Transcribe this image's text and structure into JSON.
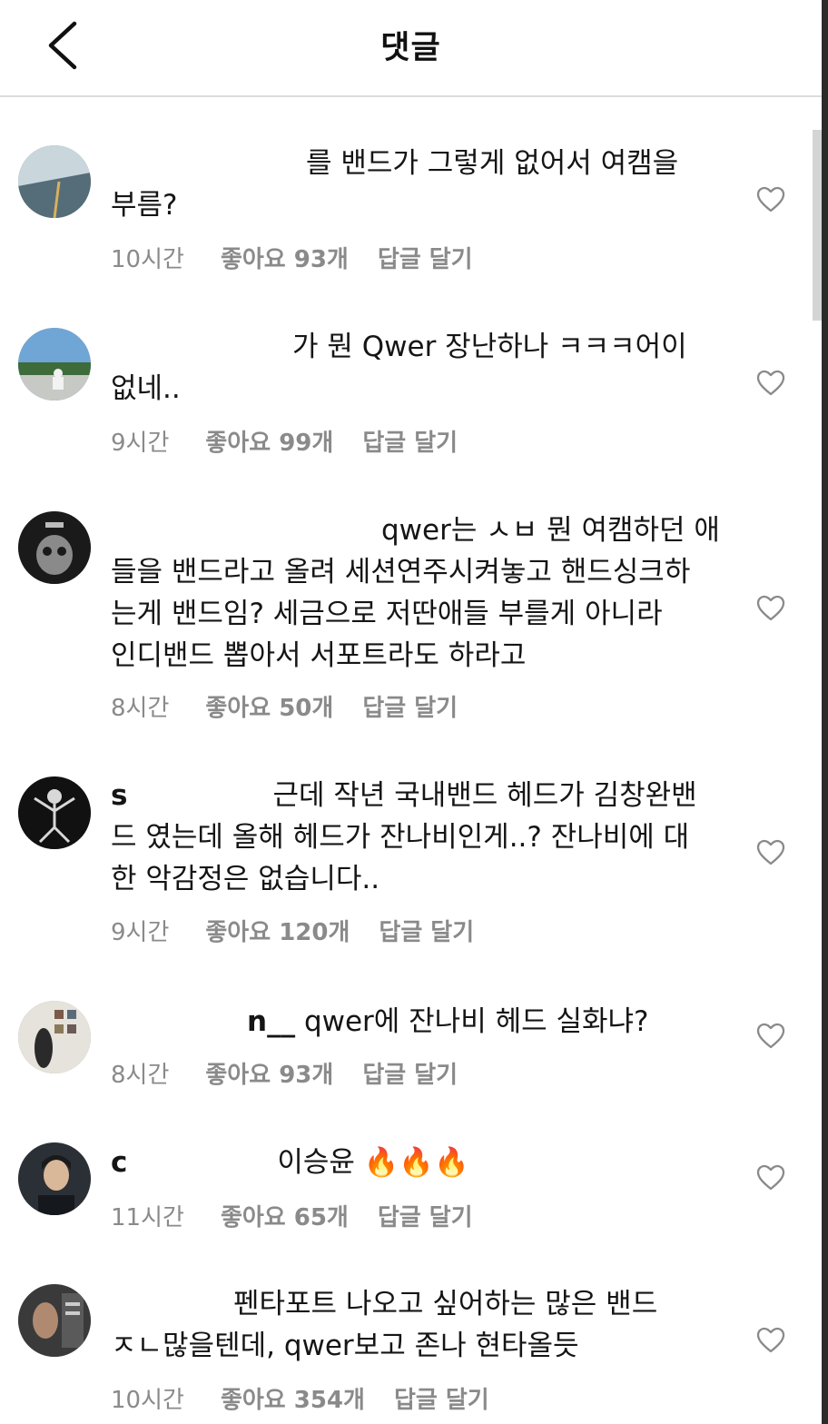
{
  "header": {
    "title": "댓글"
  },
  "comments": [
    {
      "user": "",
      "text": "를 밴드가 그렇게 없어서 여캠을\n부름?",
      "time": "10시간",
      "likes": "좋아요 93개",
      "reply": "답글 달기"
    },
    {
      "user": "",
      "text": "가 뭔 Qwer 장난하나 ㅋㅋㅋ어이\n없네..",
      "time": "9시간",
      "likes": "좋아요 99개",
      "reply": "답글 달기"
    },
    {
      "user": "",
      "text": "qwer는 ㅅㅂ 뭔 여캠하던 애\n들을 밴드라고 올려 세션연주시켜놓고 핸드싱크하\n는게 밴드임? 세금으로 저딴애들 부를게 아니라\n인디밴드 뽑아서 서포트라도 하라고",
      "time": "8시간",
      "likes": "좋아요 50개",
      "reply": "답글 달기"
    },
    {
      "user": "s",
      "text": "근데 작년 국내밴드 헤드가 김창완밴\n드 였는데 올해 헤드가 잔나비인게..? 잔나비에 대\n한 악감정은 없습니다..",
      "time": "9시간",
      "likes": "좋아요 120개",
      "reply": "답글 달기"
    },
    {
      "user": "n__",
      "text": "qwer에 잔나비 헤드 실화냐?",
      "time": "8시간",
      "likes": "좋아요 93개",
      "reply": "답글 달기"
    },
    {
      "user": "c",
      "text": "이승윤 🔥🔥🔥",
      "time": "11시간",
      "likes": "좋아요 65개",
      "reply": "답글 달기"
    },
    {
      "user": "",
      "text": "펜타포트 나오고 싶어하는 많은 밴드\nㅈㄴ많을텐데, qwer보고 존나 현타올듯",
      "time": "10시간",
      "likes": "좋아요 354개",
      "reply": "답글 달기"
    }
  ]
}
